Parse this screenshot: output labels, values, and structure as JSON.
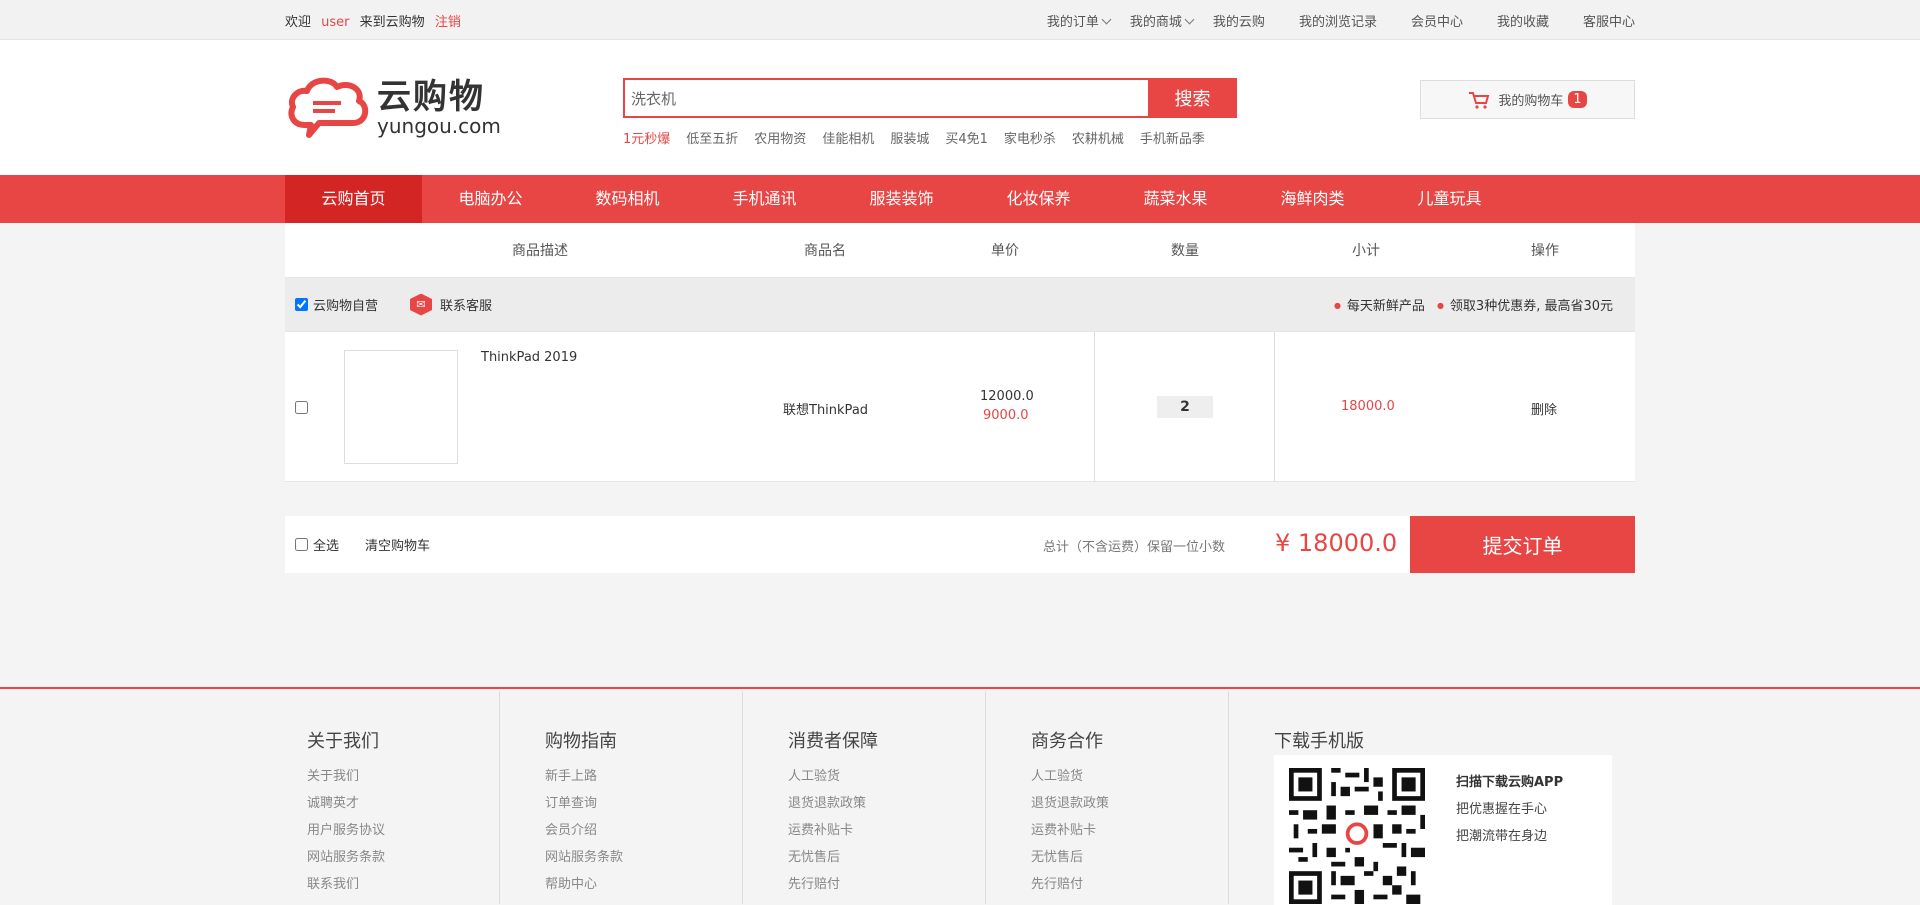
{
  "topbar": {
    "welcome": "欢迎",
    "username": "user",
    "welcome_suffix": "来到云购物",
    "logout": "注销",
    "links": [
      "我的订单",
      "我的商城",
      "我的云购",
      "我的浏览记录",
      "会员中心",
      "我的收藏",
      "客服中心"
    ]
  },
  "logo": {
    "cn": "云购物",
    "en": "yungou.com"
  },
  "search": {
    "value": "洗衣机",
    "button": "搜索"
  },
  "hotwords": [
    "1元秒爆",
    "低至五折",
    "农用物资",
    "佳能相机",
    "服装城",
    "买4免1",
    "家电秒杀",
    "农耕机械",
    "手机新品季"
  ],
  "cart_widget": {
    "label": "我的购物车",
    "count": "1"
  },
  "nav": [
    "云购首页",
    "电脑办公",
    "数码相机",
    "手机通讯",
    "服装装饰",
    "化妆保养",
    "蔬菜水果",
    "海鲜肉类",
    "儿童玩具"
  ],
  "cart": {
    "headers": [
      "商品描述",
      "商品名",
      "单价",
      "数量",
      "小计",
      "操作"
    ],
    "shop_label": "云购物自营",
    "service_label": "联系客服",
    "promo": [
      "每天新鲜产品",
      "领取3种优惠券, 最高省30元"
    ],
    "item": {
      "desc": "ThinkPad 2019",
      "name": "联想ThinkPad",
      "original_price": "12000.0",
      "price": "9000.0",
      "quantity": "2",
      "subtotal": "18000.0",
      "action": "删除"
    },
    "select_all": "全选",
    "clear": "清空购物车",
    "total_label": "总计（不含运费）保留一位小数",
    "total": "¥ 18000.0",
    "submit": "提交订单"
  },
  "footer": {
    "columns": [
      {
        "title": "关于我们",
        "links": [
          "关于我们",
          "诚聘英才",
          "用户服务协议",
          "网站服务条款",
          "联系我们"
        ]
      },
      {
        "title": "购物指南",
        "links": [
          "新手上路",
          "订单查询",
          "会员介绍",
          "网站服务条款",
          "帮助中心"
        ]
      },
      {
        "title": "消费者保障",
        "links": [
          "人工验货",
          "退货退款政策",
          "运费补贴卡",
          "无忧售后",
          "先行赔付"
        ]
      },
      {
        "title": "商务合作",
        "links": [
          "人工验货",
          "退货退款政策",
          "运费补贴卡",
          "无忧售后",
          "先行赔付"
        ]
      }
    ],
    "app": {
      "title": "下载手机版",
      "lines": [
        "扫描下载云购APP",
        "把优惠握在手心",
        "把潮流带在身边"
      ]
    }
  },
  "colors": {
    "accent": "#e84545",
    "accent_dark": "#d42525"
  }
}
